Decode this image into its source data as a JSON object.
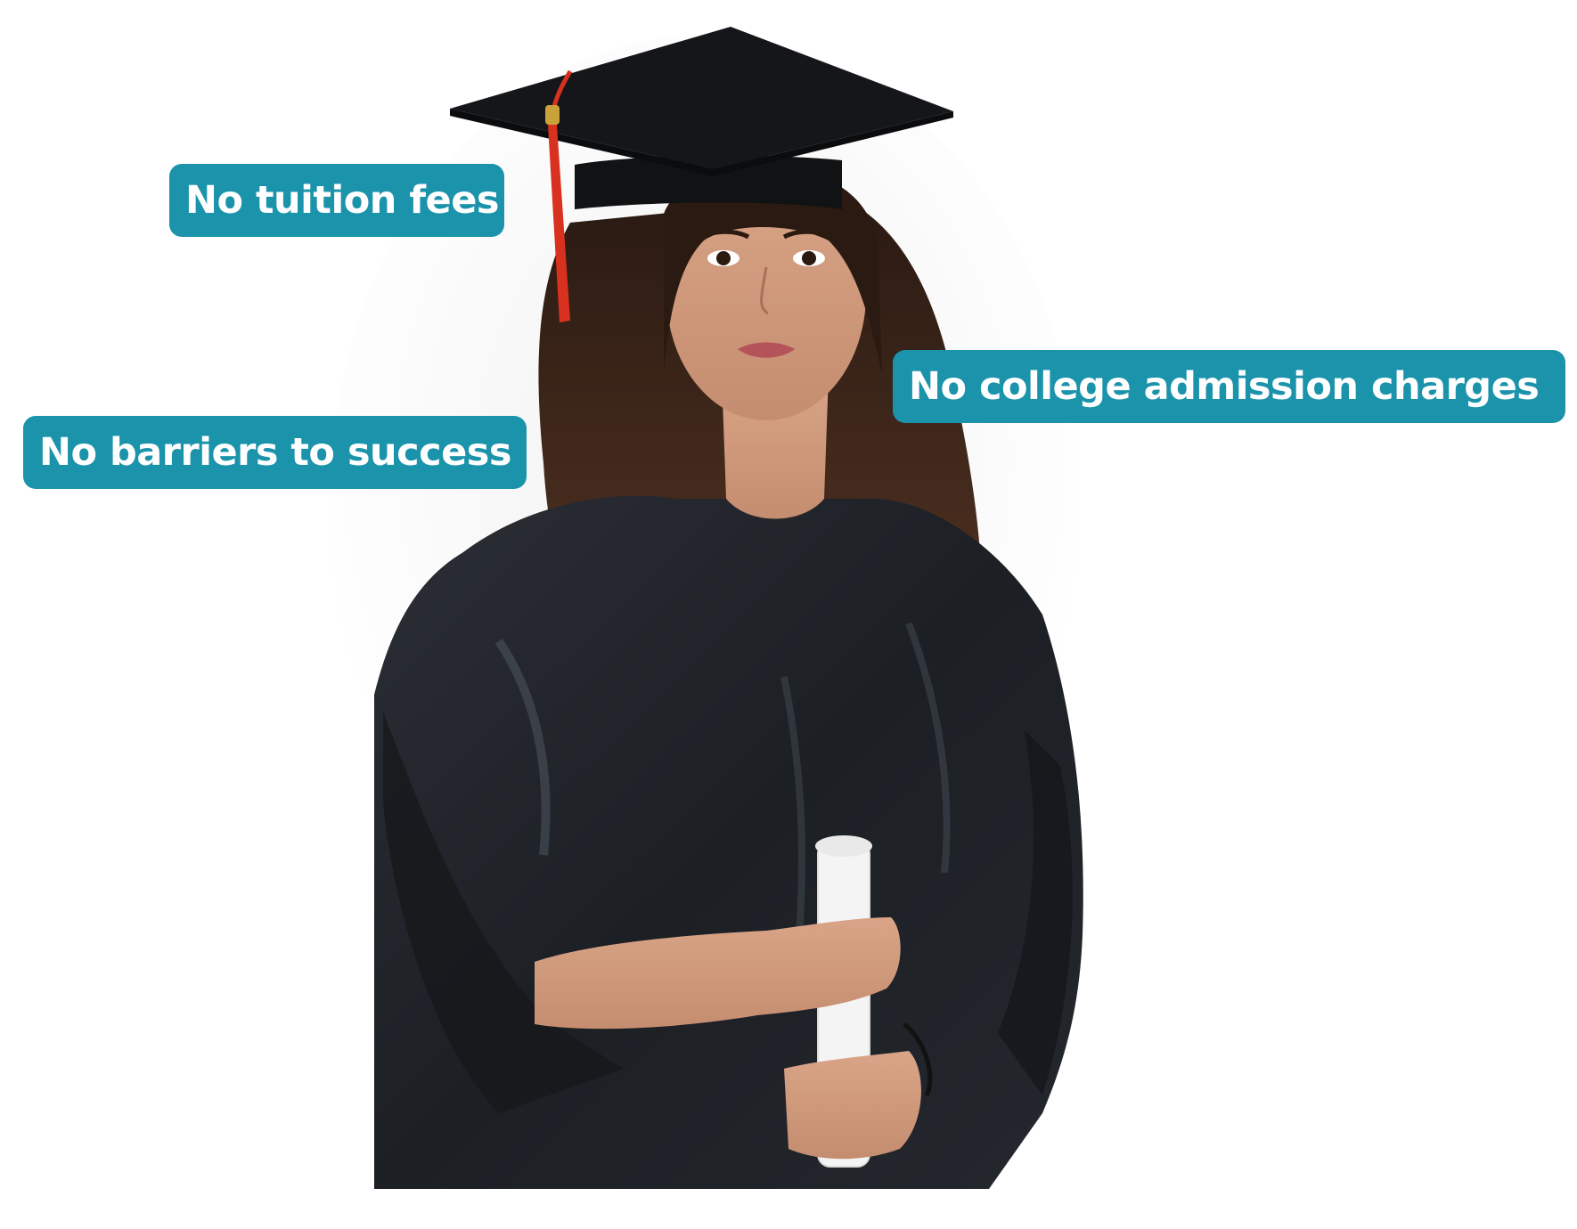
{
  "badges": [
    {
      "label": "No tuition fees"
    },
    {
      "label": "No college admission charges"
    },
    {
      "label": "No barriers to success"
    }
  ],
  "colors": {
    "badge_background": "#1a93ab",
    "badge_text": "#ffffff",
    "background": "#ffffff",
    "gown": "#1e2126",
    "tassel": "#d9311f",
    "diploma": "#f4f4f4"
  },
  "icons": [
    "graduate-photo"
  ]
}
